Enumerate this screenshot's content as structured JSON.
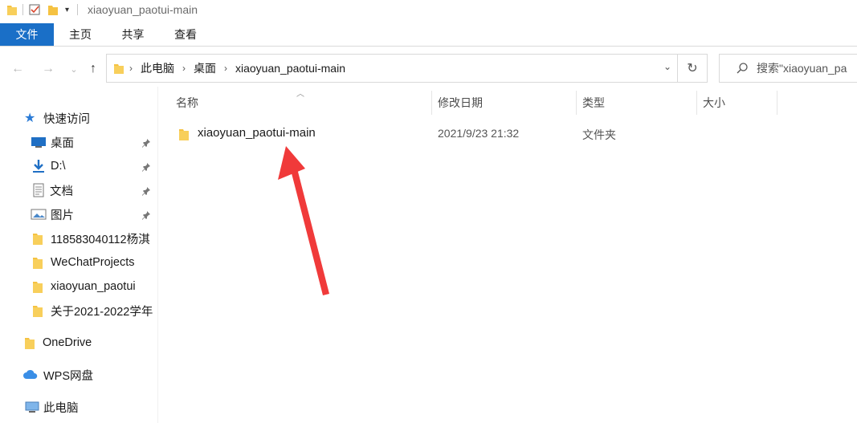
{
  "window": {
    "title": "xiaoyuan_paotui-main"
  },
  "ribbon": {
    "tabs": [
      "文件",
      "主页",
      "共享",
      "查看"
    ]
  },
  "address": {
    "crumbs": [
      "此电脑",
      "桌面",
      "xiaoyuan_paotui-main"
    ]
  },
  "search": {
    "placeholder": "搜索\"xiaoyuan_pa"
  },
  "sidebar": {
    "quick_access": "快速访问",
    "items": [
      {
        "label": "桌面",
        "icon": "desktop-icon",
        "pinned": true
      },
      {
        "label": "D:\\",
        "icon": "download-icon",
        "pinned": true
      },
      {
        "label": "文档",
        "icon": "document-icon",
        "pinned": true
      },
      {
        "label": "图片",
        "icon": "picture-icon",
        "pinned": true
      },
      {
        "label": "118583040112杨淇",
        "icon": "folder-icon",
        "pinned": false
      },
      {
        "label": "WeChatProjects",
        "icon": "folder-icon",
        "pinned": false
      },
      {
        "label": "xiaoyuan_paotui",
        "icon": "folder-icon",
        "pinned": false
      },
      {
        "label": "关于2021-2022学年",
        "icon": "folder-icon",
        "pinned": false
      }
    ],
    "onedrive": "OneDrive",
    "wps": "WPS网盘",
    "this_pc": "此电脑"
  },
  "columns": {
    "name": "名称",
    "modified": "修改日期",
    "type": "类型",
    "size": "大小"
  },
  "files": [
    {
      "name": "xiaoyuan_paotui-main",
      "modified": "2021/9/23 21:32",
      "type": "文件夹",
      "size": ""
    }
  ],
  "colors": {
    "accent": "#1a6fc7",
    "folder": "#f5c242",
    "annotation_arrow": "#f03a3a"
  }
}
